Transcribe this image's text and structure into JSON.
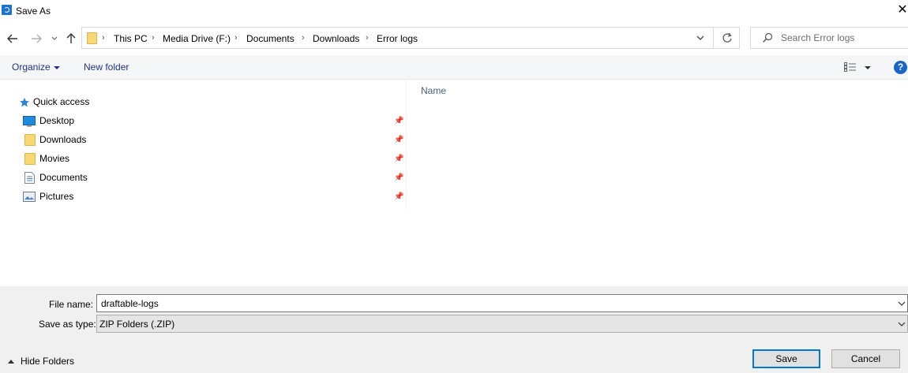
{
  "window": {
    "title": "Save As",
    "close": "✕"
  },
  "nav": {
    "back": "←",
    "forward": "→",
    "recent": "⌄",
    "up": "↑"
  },
  "address": {
    "crumbs": [
      "This PC",
      "Media Drive (F:)",
      "Documents",
      "Downloads",
      "Error logs"
    ],
    "separator": "›",
    "dropdown": "⌄",
    "refresh": "↻"
  },
  "search": {
    "placeholder": "Search Error logs",
    "icon": "search-icon"
  },
  "toolbar": {
    "organize_label": "Organize",
    "new_folder_label": "New folder",
    "help": "?"
  },
  "sidebar": {
    "quick_access_label": "Quick access",
    "items": [
      {
        "label": "Desktop",
        "icon": "desktop-icon",
        "pinned": true
      },
      {
        "label": "Downloads",
        "icon": "folder-icon",
        "pinned": true
      },
      {
        "label": "Movies",
        "icon": "folder-icon",
        "pinned": true
      },
      {
        "label": "Documents",
        "icon": "documents-icon",
        "pinned": true
      },
      {
        "label": "Pictures",
        "icon": "pictures-icon",
        "pinned": true
      }
    ]
  },
  "content": {
    "column_name": "Name"
  },
  "form": {
    "file_name_label": "File name:",
    "file_name_value": "draftable-logs",
    "save_type_label": "Save as type:",
    "save_type_value": "ZIP Folders (.ZIP)"
  },
  "footer": {
    "hide_folders_label": "Hide Folders",
    "save_label": "Save",
    "cancel_label": "Cancel"
  },
  "colors": {
    "accent": "#0078d7",
    "link": "#1e3287",
    "folder": "#f8d775"
  }
}
